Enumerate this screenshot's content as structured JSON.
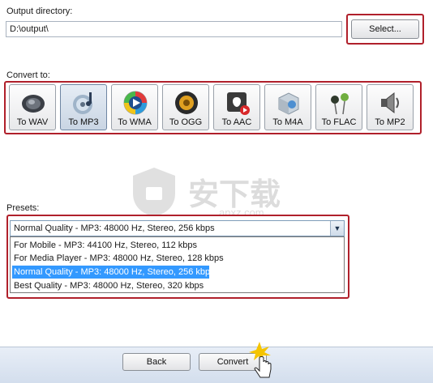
{
  "output": {
    "label": "Output directory:",
    "value": "D:\\output\\",
    "select_label": "Select..."
  },
  "convert": {
    "label": "Convert to:",
    "buttons": [
      {
        "label": "To WAV",
        "icon": "speaker-icon"
      },
      {
        "label": "To MP3",
        "icon": "cd-icon",
        "active": true
      },
      {
        "label": "To WMA",
        "icon": "windows-media-icon"
      },
      {
        "label": "To OGG",
        "icon": "ogg-speaker-icon"
      },
      {
        "label": "To AAC",
        "icon": "apple-icon"
      },
      {
        "label": "To M4A",
        "icon": "m4a-box-icon"
      },
      {
        "label": "To FLAC",
        "icon": "earbuds-icon"
      },
      {
        "label": "To MP2",
        "icon": "loudspeaker-icon"
      }
    ]
  },
  "presets": {
    "label": "Presets:",
    "selected": "Normal Quality - MP3: 48000 Hz, Stereo, 256 kbps",
    "options": [
      "For Mobile - MP3: 44100 Hz, Stereo, 112 kbps",
      "For Media Player - MP3: 48000 Hz, Stereo, 128 kbps",
      "Normal Quality - MP3: 48000 Hz, Stereo, 256 kbps",
      "Best Quality - MP3: 48000 Hz, Stereo, 320 kbps"
    ],
    "highlighted_index": 2
  },
  "footer": {
    "back_label": "Back",
    "convert_label": "Convert"
  },
  "watermark": {
    "text": "安下载",
    "sub": "anxz.com"
  },
  "colors": {
    "highlight_border": "#b0202b",
    "selection": "#3399ff",
    "footer_bg": "#dbe4f0"
  }
}
